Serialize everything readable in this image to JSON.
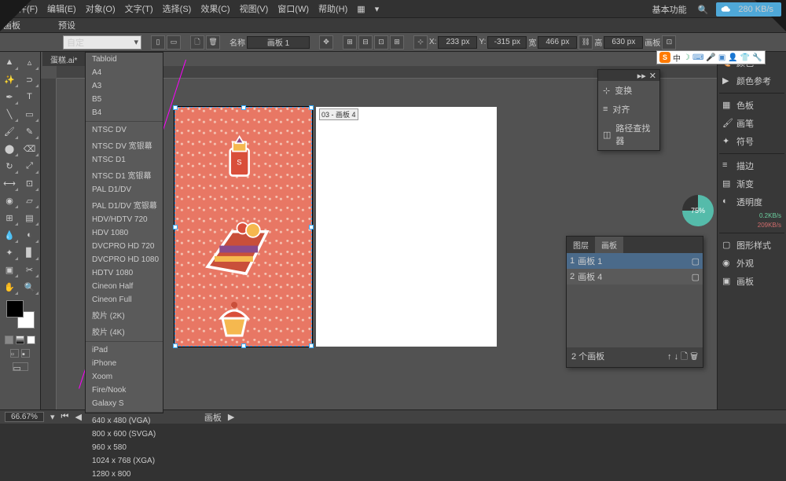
{
  "menu": {
    "file": "文件(F)",
    "edit": "编辑(E)",
    "object": "对象(O)",
    "type": "文字(T)",
    "select": "选择(S)",
    "effect": "效果(C)",
    "view": "视图(V)",
    "window": "窗口(W)",
    "help": "帮助(H)"
  },
  "topright": {
    "basic": "基本功能",
    "speed": "280 KB/s"
  },
  "bar2": {
    "artboard": "画板",
    "preset": "预设",
    "preset_val": "自定",
    "name_lbl": "名称",
    "name_val": "画板 1"
  },
  "ctrl": {
    "x_lbl": "X:",
    "x": "233 px",
    "y_lbl": "Y:",
    "y": "-315 px",
    "w_lbl": "宽",
    "w": "466 px",
    "h_lbl": "高",
    "h": "630 px",
    "ab_lbl": "画板"
  },
  "doc_tab": "蛋糕.ai*",
  "ab2_label": "03 - 画板 4",
  "dropdown": [
    "Tabloid",
    "A4",
    "A3",
    "B5",
    "B4",
    "-",
    "NTSC DV",
    "NTSC DV 宽银幕",
    "NTSC D1",
    "NTSC D1 宽银幕",
    "PAL D1/DV",
    "PAL D1/DV 宽银幕",
    "HDV/HDTV 720",
    "HDV 1080",
    "DVCPRO HD 720",
    "DVCPRO HD 1080",
    "HDTV 1080",
    "Cineon Half",
    "Cineon Full",
    "胶片 (2K)",
    "胶片 (4K)",
    "-",
    "iPad",
    "iPhone",
    "Xoom",
    "Fire/Nook",
    "Galaxy S",
    "-",
    "640 x 480 (VGA)",
    "800 x 600 (SVGA)",
    "960 x 580",
    "1024 x 768 (XGA)",
    "1280 x 800"
  ],
  "transform_panel": {
    "t": "变换",
    "a": "对齐",
    "p": "路径查找器"
  },
  "layers": {
    "tab1": "图层",
    "tab2": "画板",
    "r1_idx": "1",
    "r1": "画板 1",
    "r2_idx": "2",
    "r2": "画板 4",
    "footer": "2 个画板"
  },
  "right": {
    "color": "颜色",
    "guide": "颜色参考",
    "swatch": "色板",
    "brush": "画笔",
    "symbol": "符号",
    "stroke": "描边",
    "grad": "渐变",
    "opacity": "透明度",
    "gstyle": "图形样式",
    "appear": "外观",
    "lib": "画板"
  },
  "opacity_val": "75%",
  "opacity_meta1": "0.2KB/s",
  "opacity_meta2": "209KB/s",
  "status": {
    "zoom": "66.67%",
    "label": "画板"
  },
  "sogou": {
    "cn": "中"
  }
}
